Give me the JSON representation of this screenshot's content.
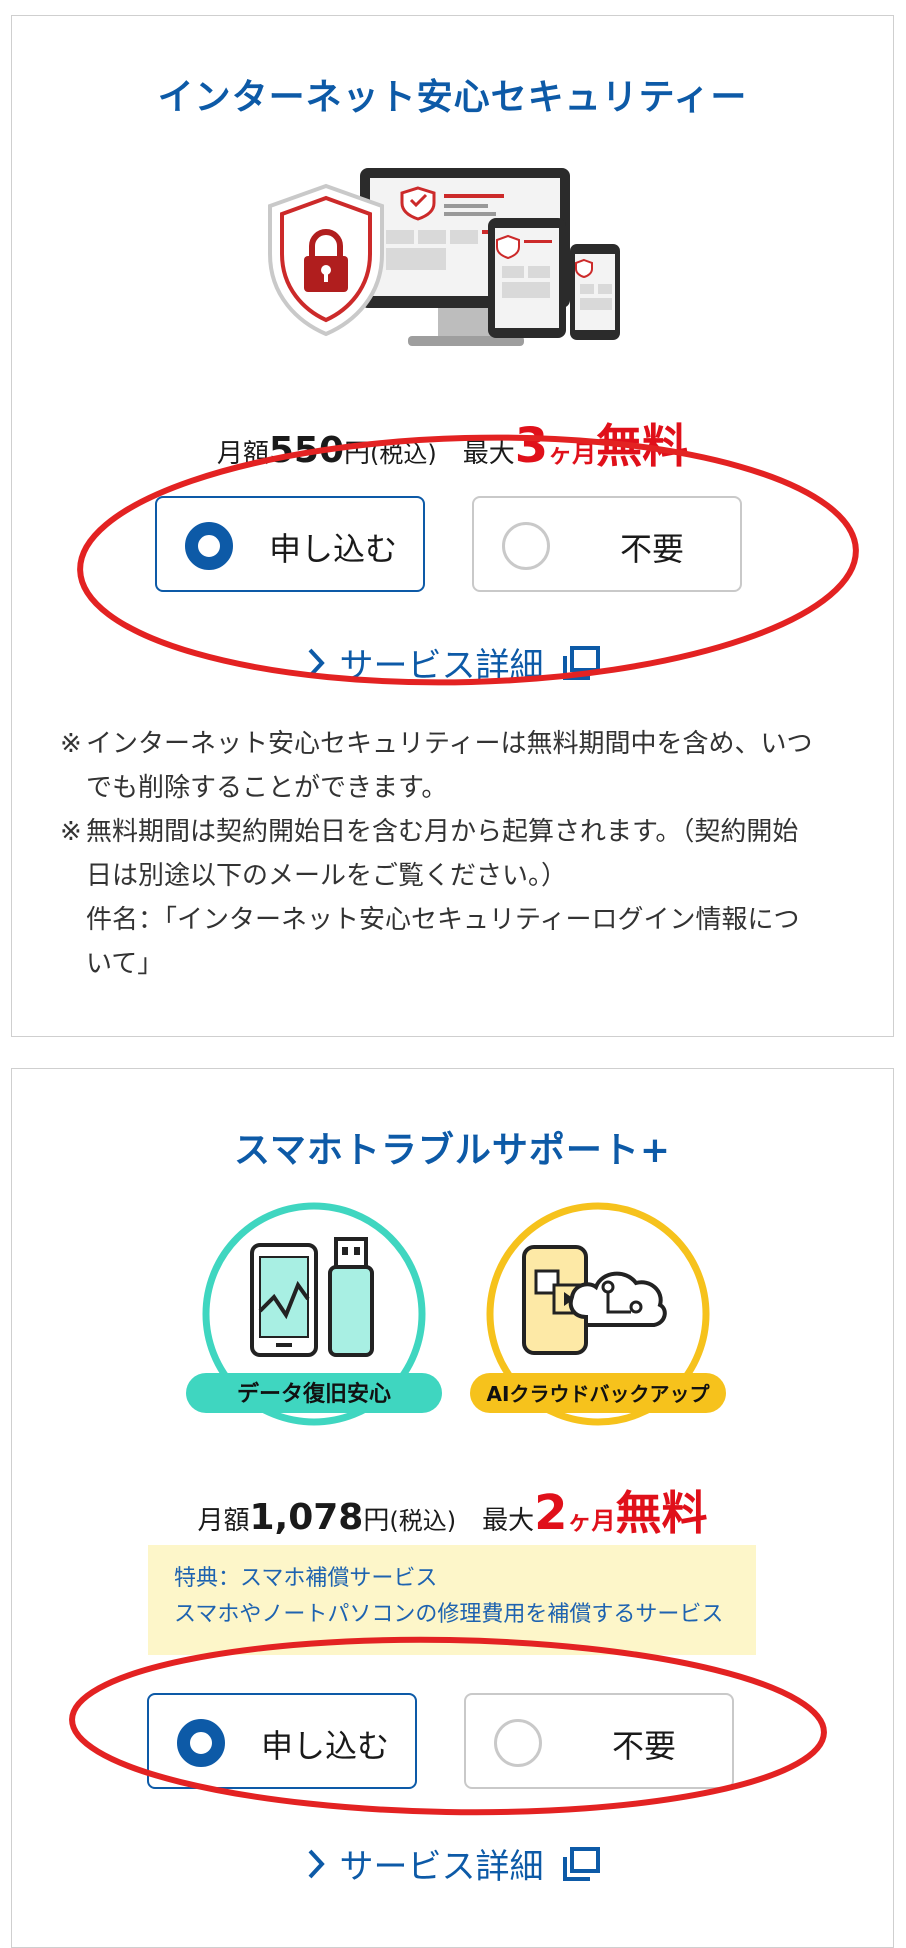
{
  "security": {
    "title": "インターネット安心セキュリティー",
    "price": {
      "prefix": "月額",
      "amount": "550",
      "unit": "円",
      "tax": "(税込)",
      "max": "最大",
      "months_num": "3",
      "months_unit": "ヶ月",
      "free": "無料"
    },
    "options": {
      "apply": "申し込む",
      "decline": "不要",
      "selected": "apply"
    },
    "detail_link": "サービス詳細",
    "notes": [
      {
        "mark": "※",
        "text": "インターネット安心セキュリティーは無料期間中を含め、いつ"
      },
      {
        "mark": "",
        "text": "でも削除することができます。"
      },
      {
        "mark": "※",
        "text": "無料期間は契約開始日を含む月から起算されます。（契約開始"
      },
      {
        "mark": "",
        "text": "日は別途以下のメールをご覧ください。）"
      },
      {
        "mark": "",
        "text": "件名：「インターネット安心セキュリティーログイン情報につ"
      },
      {
        "mark": "",
        "text": "いて」"
      }
    ]
  },
  "support": {
    "title": "スマホトラブルサポート+",
    "badges": [
      "データ復旧安心",
      "AIクラウドバックアップ"
    ],
    "price": {
      "prefix": "月額",
      "amount": "1,078",
      "unit": "円",
      "tax": "(税込)",
      "max": "最大",
      "months_num": "2",
      "months_unit": "ヶ月",
      "free": "無料"
    },
    "benefit": {
      "line1": "特典：スマホ補償サービス",
      "line2": "スマホやノートパソコンの修理費用を補償するサービス"
    },
    "options": {
      "apply": "申し込む",
      "decline": "不要",
      "selected": "apply"
    },
    "detail_link": "サービス詳細"
  },
  "colors": {
    "brand_blue": "#0d5aa7",
    "accent_red": "#e0101a",
    "teal": "#3fd6c0",
    "yellow": "#f6c21c",
    "benefit_bg": "#fdf6c9"
  }
}
